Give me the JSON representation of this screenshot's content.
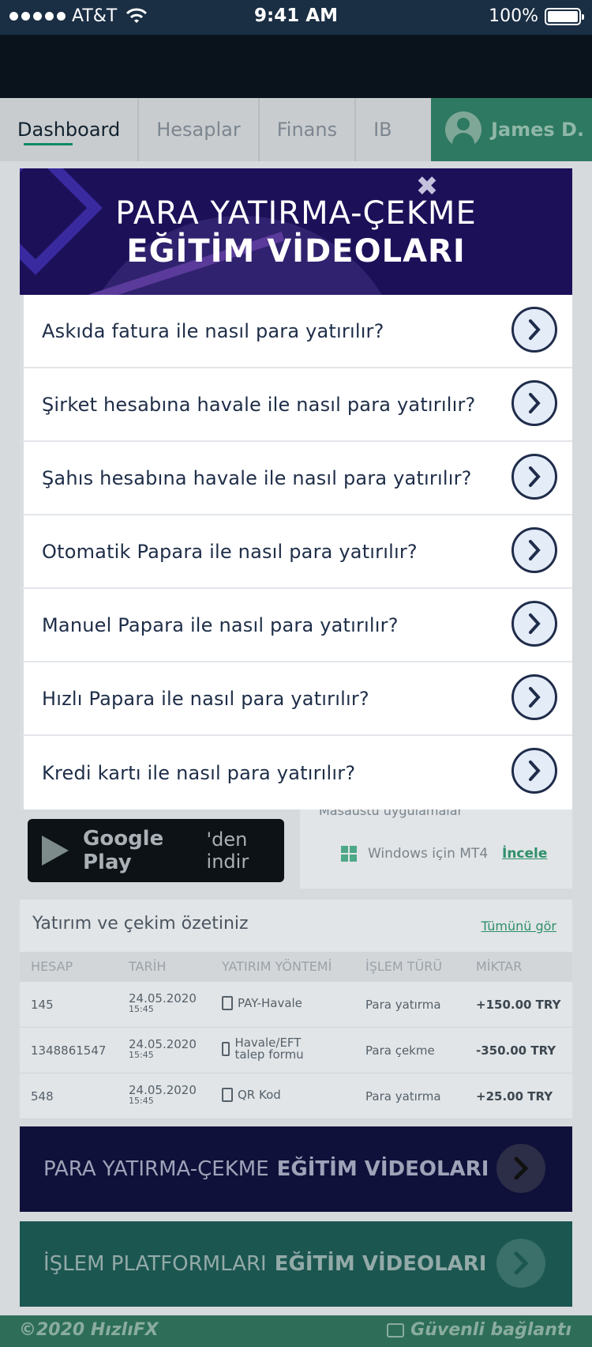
{
  "status_bar": {
    "carrier": "AT&T",
    "time": "9:41 AM",
    "battery": "100%"
  },
  "nav": {
    "tabs": [
      "Dashboard",
      "Hesaplar",
      "Finans",
      "IB"
    ],
    "user_name": "James D."
  },
  "background": {
    "google_play": {
      "brand": "Google Play",
      "suffix": "'den indir"
    },
    "desktop_apps": {
      "label": "Masaüstü uygulamalar",
      "item": "Windows için MT4",
      "link": "İncele"
    },
    "summary": {
      "title": "Yatırım ve çekim özetiniz",
      "view_all": "Tümünü gör",
      "columns": [
        "HESAP",
        "TARİH",
        "YATIRIM YÖNTEMİ",
        "İŞLEM TÜRÜ",
        "MİKTAR"
      ],
      "rows": [
        {
          "account": "145",
          "date": "24.05.2020",
          "time": "15:45",
          "method": "PAY-Havale",
          "type": "Para yatırma",
          "amount": "+150.00 TRY"
        },
        {
          "account": "1348861547",
          "date": "24.05.2020",
          "time": "15:45",
          "method": "Havale/EFT talep formu",
          "type": "Para çekme",
          "amount": "-350.00 TRY"
        },
        {
          "account": "548",
          "date": "24.05.2020",
          "time": "15:45",
          "method": "QR Kod",
          "type": "Para yatırma",
          "amount": "+25.00 TRY"
        }
      ]
    },
    "banner1": {
      "light": "PARA YATIRMA-ÇEKME",
      "bold": "EĞİTİM VİDEOLARI"
    },
    "banner2": {
      "light": "İŞLEM PLATFORMLARI",
      "bold": "EĞİTİM VİDEOLARI"
    },
    "footer": {
      "copyright": "©2020 HızlıFX",
      "secure": "Güvenli bağlantı"
    }
  },
  "modal": {
    "title_line1": "PARA YATIRMA-ÇEKME",
    "title_line2": "EĞİTİM VİDEOLARI",
    "close": "✖",
    "items": [
      "Askıda fatura ile nasıl para yatırılır?",
      "Şirket hesabına havale ile nasıl para yatırılır?",
      "Şahıs hesabına havale ile nasıl para yatırılır?",
      "Otomatik Papara ile nasıl para yatırılır?",
      "Manuel Papara ile nasıl para yatırılır?",
      "Hızlı Papara ile nasıl para yatırılır?",
      "Kredi kartı ile nasıl para yatırılır?"
    ]
  }
}
